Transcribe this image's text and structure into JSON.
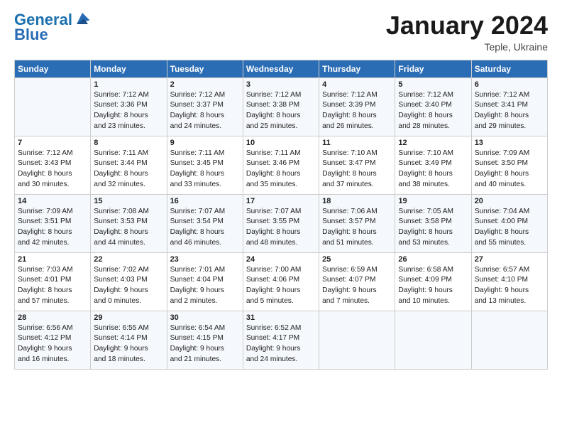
{
  "header": {
    "logo_line1": "General",
    "logo_line2": "Blue",
    "month_title": "January 2024",
    "location": "Teple, Ukraine"
  },
  "days_of_week": [
    "Sunday",
    "Monday",
    "Tuesday",
    "Wednesday",
    "Thursday",
    "Friday",
    "Saturday"
  ],
  "weeks": [
    [
      {
        "day": "",
        "info": ""
      },
      {
        "day": "1",
        "info": "Sunrise: 7:12 AM\nSunset: 3:36 PM\nDaylight: 8 hours\nand 23 minutes."
      },
      {
        "day": "2",
        "info": "Sunrise: 7:12 AM\nSunset: 3:37 PM\nDaylight: 8 hours\nand 24 minutes."
      },
      {
        "day": "3",
        "info": "Sunrise: 7:12 AM\nSunset: 3:38 PM\nDaylight: 8 hours\nand 25 minutes."
      },
      {
        "day": "4",
        "info": "Sunrise: 7:12 AM\nSunset: 3:39 PM\nDaylight: 8 hours\nand 26 minutes."
      },
      {
        "day": "5",
        "info": "Sunrise: 7:12 AM\nSunset: 3:40 PM\nDaylight: 8 hours\nand 28 minutes."
      },
      {
        "day": "6",
        "info": "Sunrise: 7:12 AM\nSunset: 3:41 PM\nDaylight: 8 hours\nand 29 minutes."
      }
    ],
    [
      {
        "day": "7",
        "info": "Sunrise: 7:12 AM\nSunset: 3:43 PM\nDaylight: 8 hours\nand 30 minutes."
      },
      {
        "day": "8",
        "info": "Sunrise: 7:11 AM\nSunset: 3:44 PM\nDaylight: 8 hours\nand 32 minutes."
      },
      {
        "day": "9",
        "info": "Sunrise: 7:11 AM\nSunset: 3:45 PM\nDaylight: 8 hours\nand 33 minutes."
      },
      {
        "day": "10",
        "info": "Sunrise: 7:11 AM\nSunset: 3:46 PM\nDaylight: 8 hours\nand 35 minutes."
      },
      {
        "day": "11",
        "info": "Sunrise: 7:10 AM\nSunset: 3:47 PM\nDaylight: 8 hours\nand 37 minutes."
      },
      {
        "day": "12",
        "info": "Sunrise: 7:10 AM\nSunset: 3:49 PM\nDaylight: 8 hours\nand 38 minutes."
      },
      {
        "day": "13",
        "info": "Sunrise: 7:09 AM\nSunset: 3:50 PM\nDaylight: 8 hours\nand 40 minutes."
      }
    ],
    [
      {
        "day": "14",
        "info": "Sunrise: 7:09 AM\nSunset: 3:51 PM\nDaylight: 8 hours\nand 42 minutes."
      },
      {
        "day": "15",
        "info": "Sunrise: 7:08 AM\nSunset: 3:53 PM\nDaylight: 8 hours\nand 44 minutes."
      },
      {
        "day": "16",
        "info": "Sunrise: 7:07 AM\nSunset: 3:54 PM\nDaylight: 8 hours\nand 46 minutes."
      },
      {
        "day": "17",
        "info": "Sunrise: 7:07 AM\nSunset: 3:55 PM\nDaylight: 8 hours\nand 48 minutes."
      },
      {
        "day": "18",
        "info": "Sunrise: 7:06 AM\nSunset: 3:57 PM\nDaylight: 8 hours\nand 51 minutes."
      },
      {
        "day": "19",
        "info": "Sunrise: 7:05 AM\nSunset: 3:58 PM\nDaylight: 8 hours\nand 53 minutes."
      },
      {
        "day": "20",
        "info": "Sunrise: 7:04 AM\nSunset: 4:00 PM\nDaylight: 8 hours\nand 55 minutes."
      }
    ],
    [
      {
        "day": "21",
        "info": "Sunrise: 7:03 AM\nSunset: 4:01 PM\nDaylight: 8 hours\nand 57 minutes."
      },
      {
        "day": "22",
        "info": "Sunrise: 7:02 AM\nSunset: 4:03 PM\nDaylight: 9 hours\nand 0 minutes."
      },
      {
        "day": "23",
        "info": "Sunrise: 7:01 AM\nSunset: 4:04 PM\nDaylight: 9 hours\nand 2 minutes."
      },
      {
        "day": "24",
        "info": "Sunrise: 7:00 AM\nSunset: 4:06 PM\nDaylight: 9 hours\nand 5 minutes."
      },
      {
        "day": "25",
        "info": "Sunrise: 6:59 AM\nSunset: 4:07 PM\nDaylight: 9 hours\nand 7 minutes."
      },
      {
        "day": "26",
        "info": "Sunrise: 6:58 AM\nSunset: 4:09 PM\nDaylight: 9 hours\nand 10 minutes."
      },
      {
        "day": "27",
        "info": "Sunrise: 6:57 AM\nSunset: 4:10 PM\nDaylight: 9 hours\nand 13 minutes."
      }
    ],
    [
      {
        "day": "28",
        "info": "Sunrise: 6:56 AM\nSunset: 4:12 PM\nDaylight: 9 hours\nand 16 minutes."
      },
      {
        "day": "29",
        "info": "Sunrise: 6:55 AM\nSunset: 4:14 PM\nDaylight: 9 hours\nand 18 minutes."
      },
      {
        "day": "30",
        "info": "Sunrise: 6:54 AM\nSunset: 4:15 PM\nDaylight: 9 hours\nand 21 minutes."
      },
      {
        "day": "31",
        "info": "Sunrise: 6:52 AM\nSunset: 4:17 PM\nDaylight: 9 hours\nand 24 minutes."
      },
      {
        "day": "",
        "info": ""
      },
      {
        "day": "",
        "info": ""
      },
      {
        "day": "",
        "info": ""
      }
    ]
  ]
}
